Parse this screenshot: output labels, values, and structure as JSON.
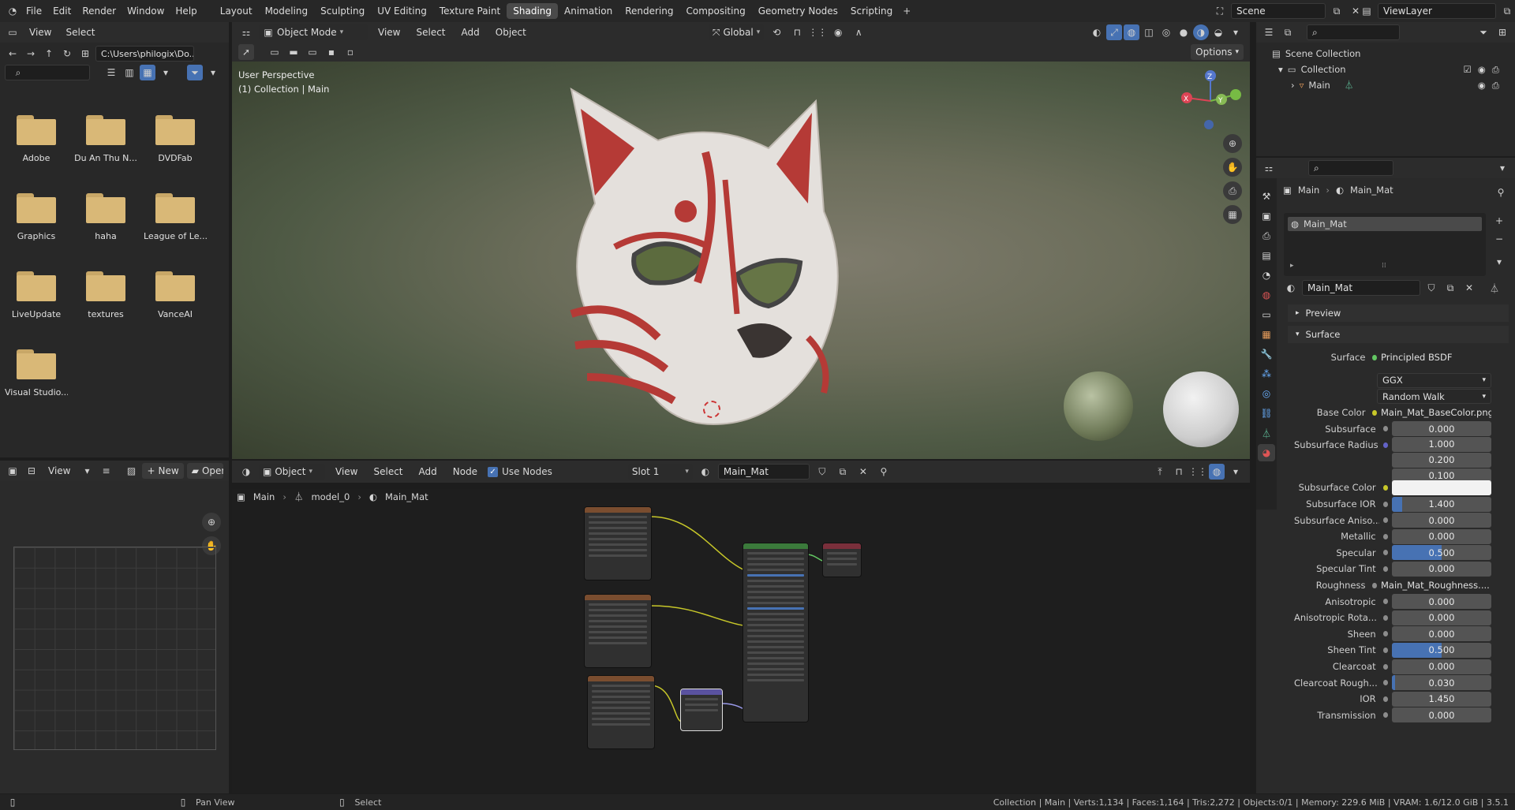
{
  "topbar": {
    "menus": [
      "File",
      "Edit",
      "Render",
      "Window",
      "Help"
    ],
    "workspaces": [
      "Layout",
      "Modeling",
      "Sculpting",
      "UV Editing",
      "Texture Paint",
      "Shading",
      "Animation",
      "Rendering",
      "Compositing",
      "Geometry Nodes",
      "Scripting"
    ],
    "active_workspace": "Shading",
    "scene": "Scene",
    "view_layer": "ViewLayer"
  },
  "filebrowser": {
    "menus": [
      "View",
      "Select"
    ],
    "path": "C:\\Users\\philogix\\Do...",
    "folders": [
      "Adobe",
      "Du An Thu N...",
      "DVDFab",
      "Graphics",
      "haha",
      "League of Le...",
      "LiveUpdate",
      "textures",
      "VanceAI",
      "Visual Studio..."
    ]
  },
  "viewport": {
    "mode": "Object Mode",
    "menus": [
      "View",
      "Select",
      "Add",
      "Object"
    ],
    "orientation": "Global",
    "options": "Options",
    "info_line1": "User Perspective",
    "info_line2": "(1) Collection | Main",
    "gizmo_axes": [
      "Z",
      "Y",
      "X"
    ]
  },
  "image_editor": {
    "view": "View",
    "new_button": "New",
    "open_button": "Open"
  },
  "node_editor": {
    "object_mode": "Object",
    "menus": [
      "View",
      "Select",
      "Add",
      "Node"
    ],
    "use_nodes": "Use Nodes",
    "slot": "Slot 1",
    "material": "Main_Mat",
    "breadcrumb": [
      "Main",
      "model_0",
      "Main_Mat"
    ]
  },
  "outliner": {
    "scene_collection": "Scene Collection",
    "collection": "Collection",
    "object": "Main"
  },
  "properties": {
    "breadcrumb_object": "Main",
    "breadcrumb_material": "Main_Mat",
    "slot_item": "Main_Mat",
    "material_name": "Main_Mat",
    "preview_label": "Preview",
    "surface_label": "Surface",
    "rows": [
      {
        "label": "Surface",
        "type": "texture",
        "value": "Principled BSDF",
        "sock": "g"
      },
      {
        "label": "",
        "type": "select",
        "value": "GGX"
      },
      {
        "label": "",
        "type": "select",
        "value": "Random Walk"
      },
      {
        "label": "Base Color",
        "type": "texture",
        "value": "Main_Mat_BaseColor.png",
        "sock": "y",
        "expand": true
      },
      {
        "label": "Subsurface",
        "type": "slider",
        "value": "0.000",
        "fill": 0
      },
      {
        "label": "Subsurface Radius",
        "type": "vec",
        "values": [
          "1.000",
          "0.200",
          "0.100"
        ],
        "sock": "p"
      },
      {
        "label": "Subsurface Color",
        "type": "color",
        "value": "",
        "sock": "y"
      },
      {
        "label": "Subsurface IOR",
        "type": "slider",
        "value": "1.400",
        "fill": 0.1
      },
      {
        "label": "Subsurface Aniso...",
        "type": "slider",
        "value": "0.000",
        "fill": 0
      },
      {
        "label": "Metallic",
        "type": "slider",
        "value": "0.000",
        "fill": 0
      },
      {
        "label": "Specular",
        "type": "slider",
        "value": "0.500",
        "fill": 0.5
      },
      {
        "label": "Specular Tint",
        "type": "slider",
        "value": "0.000",
        "fill": 0
      },
      {
        "label": "Roughness",
        "type": "texture",
        "value": "Main_Mat_Roughness....",
        "sock": "n",
        "expand": true
      },
      {
        "label": "Anisotropic",
        "type": "slider",
        "value": "0.000",
        "fill": 0
      },
      {
        "label": "Anisotropic Rota...",
        "type": "slider",
        "value": "0.000",
        "fill": 0
      },
      {
        "label": "Sheen",
        "type": "slider",
        "value": "0.000",
        "fill": 0
      },
      {
        "label": "Sheen Tint",
        "type": "slider",
        "value": "0.500",
        "fill": 0.5
      },
      {
        "label": "Clearcoat",
        "type": "slider",
        "value": "0.000",
        "fill": 0
      },
      {
        "label": "Clearcoat Rough...",
        "type": "slider",
        "value": "0.030",
        "fill": 0.03
      },
      {
        "label": "IOR",
        "type": "slider",
        "value": "1.450",
        "fill": 0
      },
      {
        "label": "Transmission",
        "type": "slider",
        "value": "0.000",
        "fill": 0
      }
    ]
  },
  "statusbar": {
    "pan_view": "Pan View",
    "select": "Select",
    "stats": "Collection | Main | Verts:1,134 | Faces:1,164 | Tris:2,272 | Objects:0/1 | Memory: 229.6 MiB | VRAM: 1.6/12.0 GiB | 3.5.1"
  },
  "colors": {
    "accent": "#4772b3",
    "folder": "#d9b877",
    "header": "#2c2c2c"
  }
}
